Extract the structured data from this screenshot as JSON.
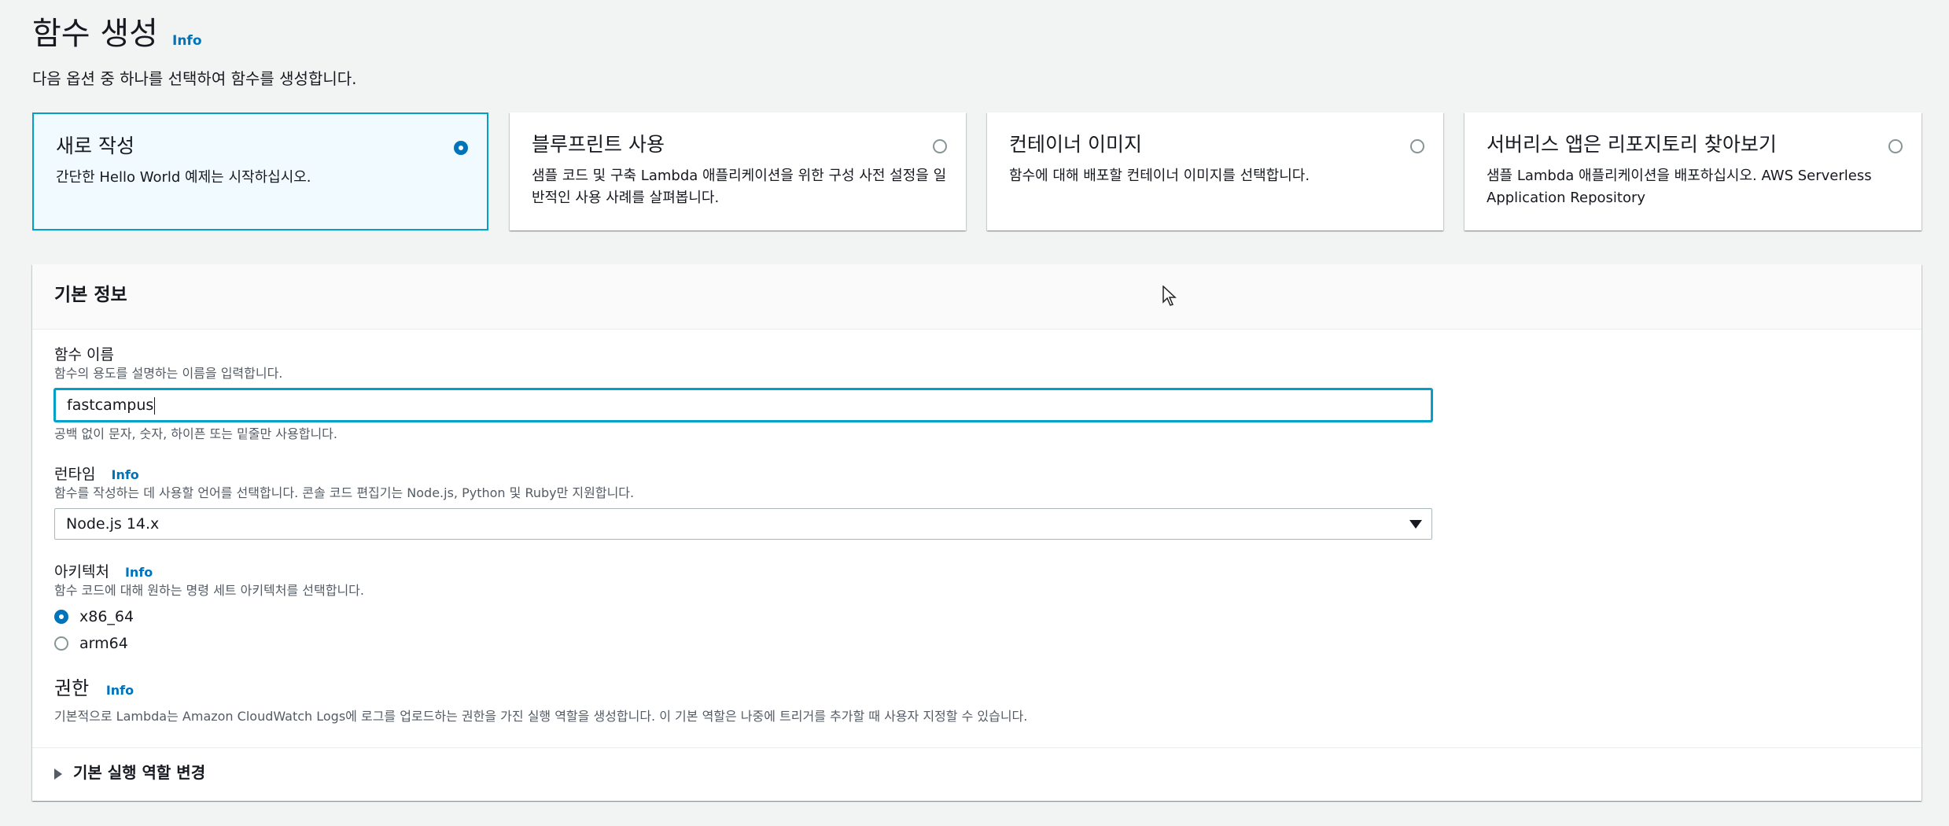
{
  "header": {
    "title": "함수 생성",
    "info": "Info",
    "subtitle": "다음 옵션 중 하나를 선택하여 함수를 생성합니다."
  },
  "options": [
    {
      "title": "새로 작성",
      "desc": "간단한 Hello World 예제는 시작하십시오.",
      "selected": true
    },
    {
      "title": "블루프린트 사용",
      "desc": "샘플 코드 및 구축 Lambda 애플리케이션을 위한 구성 사전 설정을 일반적인 사용 사례를 살펴봅니다.",
      "selected": false
    },
    {
      "title": "컨테이너 이미지",
      "desc": "함수에 대해 배포할 컨테이너 이미지를 선택합니다.",
      "selected": false
    },
    {
      "title": "서버리스 앱은 리포지토리 찾아보기",
      "desc": "샘플 Lambda 애플리케이션을 배포하십시오. AWS Serverless Application Repository",
      "selected": false
    }
  ],
  "basic": {
    "title": "기본 정보",
    "function_name": {
      "label": "함수 이름",
      "desc": "함수의 용도를 설명하는 이름을 입력합니다.",
      "value": "fastcampus",
      "hint": "공백 없이 문자, 숫자, 하이픈 또는 밑줄만 사용합니다."
    },
    "runtime": {
      "label": "런타임",
      "info": "Info",
      "desc": "함수를 작성하는 데 사용할 언어를 선택합니다. 콘솔 코드 편집기는 Node.js, Python 및 Ruby만 지원합니다.",
      "value": "Node.js 14.x"
    },
    "architecture": {
      "label": "아키텍처",
      "info": "Info",
      "desc": "함수 코드에 대해 원하는 명령 세트 아키텍처를 선택합니다.",
      "options": [
        {
          "label": "x86_64",
          "selected": true
        },
        {
          "label": "arm64",
          "selected": false
        }
      ]
    },
    "permissions": {
      "label": "권한",
      "info": "Info",
      "desc": "기본적으로 Lambda는 Amazon CloudWatch Logs에 로그를 업로드하는 권한을 가진 실행 역할을 생성합니다. 이 기본 역할은 나중에 트리거를 추가할 때 사용자 지정할 수 있습니다.",
      "expander": "기본 실행 역할 변경"
    }
  },
  "colors": {
    "accent": "#0073bb",
    "selected_border": "#00a1c9",
    "selected_bg": "#f1faff"
  }
}
